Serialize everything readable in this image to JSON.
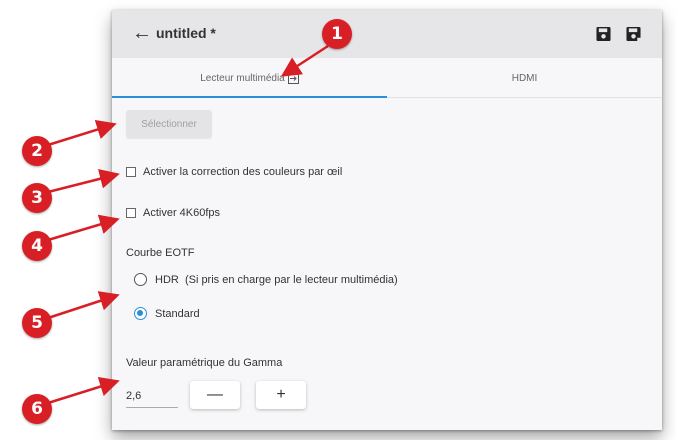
{
  "window": {
    "title": "untitled *",
    "back_icon": "arrow-left-icon",
    "save_icon": "floppy-disk-icon",
    "save_as_icon": "floppy-disk-plus-icon"
  },
  "tabs": [
    {
      "label": "Lecteur multimédia",
      "icon": "external-link-icon",
      "active": true
    },
    {
      "label": "HDMI",
      "active": false
    }
  ],
  "content": {
    "select_button": "Sélectionner",
    "checkboxes": [
      {
        "label": "Activer la correction des couleurs par œil",
        "checked": false
      },
      {
        "label": "Activer 4K60fps",
        "checked": false
      }
    ],
    "eotf": {
      "label": "Courbe EOTF",
      "options": [
        {
          "label": "HDR  (Si pris en charge par le lecteur multimédia)",
          "selected": false
        },
        {
          "label": "Standard",
          "selected": true
        }
      ]
    },
    "gamma": {
      "label": "Valeur paramétrique du Gamma",
      "value": "2,6",
      "decrement": "—",
      "increment": "+"
    }
  },
  "callouts": [
    "1",
    "2",
    "3",
    "4",
    "5",
    "6"
  ],
  "colors": {
    "accent": "#2a8fd6",
    "callout": "#d91f26",
    "topbar": "#e6e6e8",
    "panel": "#f7f7f9"
  }
}
